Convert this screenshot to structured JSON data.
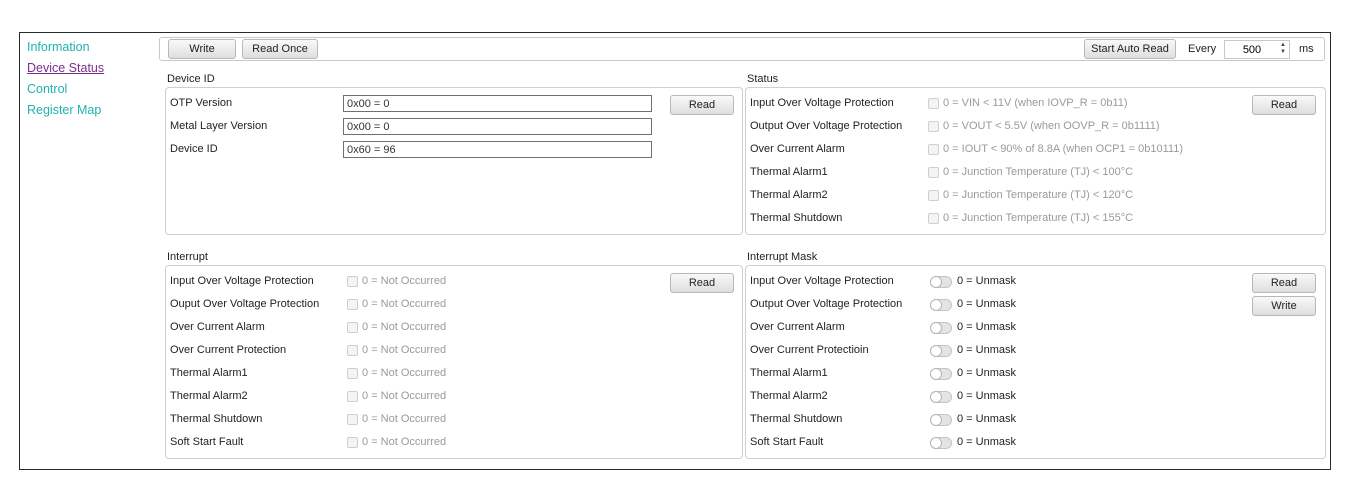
{
  "nav": {
    "items": [
      {
        "label": "Information",
        "active": false
      },
      {
        "label": "Device Status",
        "active": true
      },
      {
        "label": "Control",
        "active": false
      },
      {
        "label": "Register Map",
        "active": false
      }
    ]
  },
  "toolbar": {
    "write_label": "Write",
    "read_once_label": "Read Once",
    "start_auto_read_label": "Start Auto Read",
    "every_label": "Every",
    "interval_value": "500",
    "unit_label": "ms"
  },
  "device_id": {
    "title": "Device ID",
    "read_label": "Read",
    "rows": [
      {
        "label": "OTP Version",
        "value": "0x00 = 0"
      },
      {
        "label": "Metal Layer Version",
        "value": "0x00 = 0"
      },
      {
        "label": "Device ID",
        "value": "0x60 = 96"
      }
    ]
  },
  "status": {
    "title": "Status",
    "read_label": "Read",
    "rows": [
      {
        "label": "Input Over Voltage Protection",
        "desc": "0 = VIN < 11V (when IOVP_R = 0b11)"
      },
      {
        "label": "Output Over Voltage Protection",
        "desc": "0 = VOUT < 5.5V (when OOVP_R = 0b1111)"
      },
      {
        "label": "Over Current Alarm",
        "desc": "0 = IOUT < 90% of 8.8A (when OCP1 = 0b10111)"
      },
      {
        "label": "Thermal Alarm1",
        "desc": "0 = Junction Temperature (TJ) < 100°C"
      },
      {
        "label": "Thermal Alarm2",
        "desc": "0 = Junction Temperature (TJ) < 120°C"
      },
      {
        "label": "Thermal Shutdown",
        "desc": "0 = Junction Temperature (TJ) < 155°C"
      }
    ]
  },
  "interrupt": {
    "title": "Interrupt",
    "read_label": "Read",
    "rows": [
      {
        "label": "Input Over Voltage Protection",
        "desc": "0 = Not Occurred"
      },
      {
        "label": "Ouput Over Voltage Protection",
        "desc": "0 = Not Occurred"
      },
      {
        "label": "Over Current Alarm",
        "desc": "0 = Not Occurred"
      },
      {
        "label": "Over Current Protection",
        "desc": "0 = Not Occurred"
      },
      {
        "label": "Thermal Alarm1",
        "desc": "0 = Not Occurred"
      },
      {
        "label": "Thermal Alarm2",
        "desc": "0 = Not Occurred"
      },
      {
        "label": "Thermal Shutdown",
        "desc": "0 = Not Occurred"
      },
      {
        "label": "Soft Start Fault",
        "desc": "0 = Not Occurred"
      }
    ]
  },
  "interrupt_mask": {
    "title": "Interrupt Mask",
    "read_label": "Read",
    "write_label": "Write",
    "rows": [
      {
        "label": "Input Over Voltage Protection",
        "desc": "0 = Unmask"
      },
      {
        "label": "Output Over Voltage Protection",
        "desc": "0 = Unmask"
      },
      {
        "label": "Over Current Alarm",
        "desc": "0 = Unmask"
      },
      {
        "label": "Over Current Protectioin",
        "desc": "0 = Unmask"
      },
      {
        "label": "Thermal Alarm1",
        "desc": "0 = Unmask"
      },
      {
        "label": "Thermal Alarm2",
        "desc": "0 = Unmask"
      },
      {
        "label": "Thermal Shutdown",
        "desc": "0 = Unmask"
      },
      {
        "label": "Soft Start Fault",
        "desc": "0 = Unmask"
      }
    ]
  }
}
